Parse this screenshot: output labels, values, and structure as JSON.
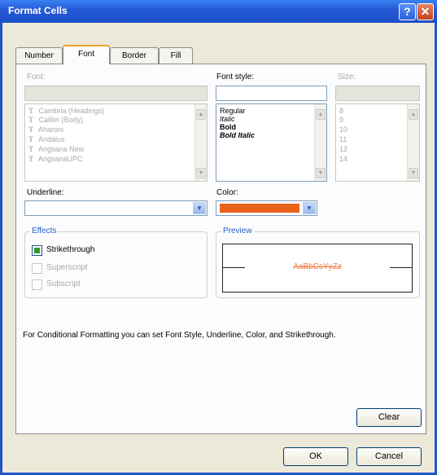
{
  "window": {
    "title": "Format Cells"
  },
  "title_buttons": {
    "help": "?",
    "close": "✕"
  },
  "tabs": [
    {
      "label": "Number"
    },
    {
      "label": "Font"
    },
    {
      "label": "Border"
    },
    {
      "label": "Fill"
    }
  ],
  "font": {
    "label": "Font:",
    "value": "",
    "items": [
      "Cambria (Headings)",
      "Calibri (Body)",
      "Aharoni",
      "Andalus",
      "Angsana New",
      "AngsanaUPC"
    ]
  },
  "font_style": {
    "label": "Font style:",
    "value": "",
    "items": [
      "Regular",
      "Italic",
      "Bold",
      "Bold Italic"
    ]
  },
  "size": {
    "label": "Size:",
    "value": "",
    "items": [
      "8",
      "9",
      "10",
      "11",
      "12",
      "14"
    ]
  },
  "underline": {
    "label": "Underline:",
    "value": ""
  },
  "color": {
    "label": "Color:",
    "swatch": "#e8621a"
  },
  "effects": {
    "label": "Effects",
    "strikethrough": "Strikethrough",
    "superscript": "Superscript",
    "subscript": "Subscript",
    "strikethrough_checked": true
  },
  "preview": {
    "label": "Preview",
    "sample": "AaBbCcYyZz",
    "sample_color": "#f07845"
  },
  "info_text": "For Conditional Formatting you can set Font Style, Underline, Color, and Strikethrough.",
  "buttons": {
    "clear": "Clear",
    "ok": "OK",
    "cancel": "Cancel"
  },
  "icons": {
    "scroll_up": "▲",
    "scroll_down": "▼",
    "dropdown": "▼",
    "truetype": "T"
  },
  "colors": {
    "titlebar": "#2458d6",
    "accent": "#1f5fcc",
    "tab_highlight": "#f0a030"
  }
}
